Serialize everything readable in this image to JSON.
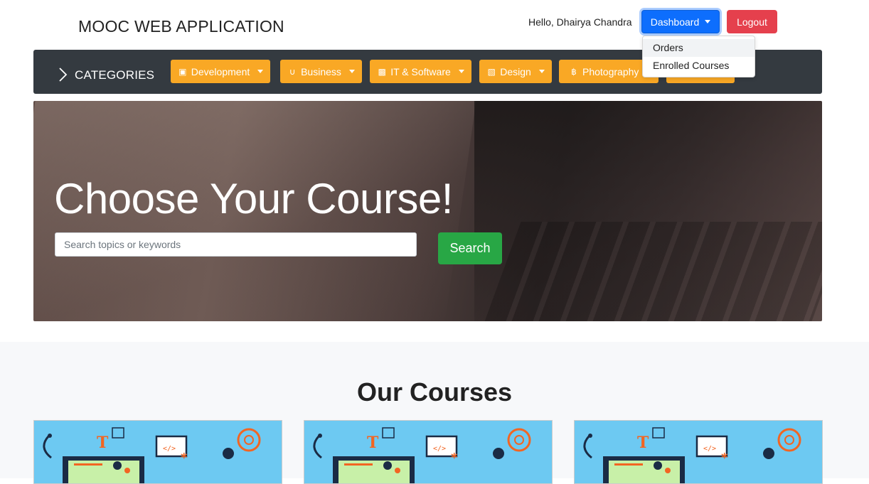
{
  "header": {
    "brand": "MOOC WEB APPLICATION",
    "greeting": "Hello, Dhairya Chandra",
    "dashboard_label": "Dashboard",
    "logout_label": "Logout",
    "dashboard_menu": [
      {
        "label": "Orders"
      },
      {
        "label": "Enrolled Courses"
      }
    ]
  },
  "categories": {
    "label": "CATEGORIES",
    "items": [
      {
        "label": "Development",
        "icon": "inbox-icon"
      },
      {
        "label": "Business",
        "icon": "magnet-icon"
      },
      {
        "label": "IT & Software",
        "icon": "code-icon"
      },
      {
        "label": "Design",
        "icon": "book-icon"
      },
      {
        "label": "Photography",
        "icon": "bitcoin-icon"
      }
    ]
  },
  "hero": {
    "title": "Choose Your Course!",
    "search_placeholder": "Search topics or keywords",
    "search_button": "Search"
  },
  "courses": {
    "title": "Our Courses"
  },
  "colors": {
    "primary": "#0d6efd",
    "danger": "#e5404d",
    "category": "#f9a825",
    "catbar": "#343a40",
    "success": "#28a745"
  }
}
